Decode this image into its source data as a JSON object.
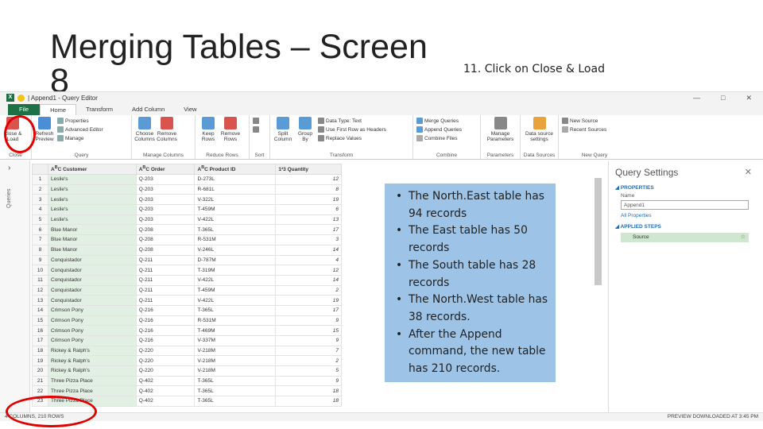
{
  "slide": {
    "title": "Merging Tables – Screen 8",
    "instruction": "11. Click on Close & Load"
  },
  "window": {
    "title": "| Append1 - Query Editor",
    "file_tab": "File",
    "tabs": [
      "Home",
      "Transform",
      "Add Column",
      "View"
    ],
    "controls": [
      "—",
      "□",
      "✕"
    ]
  },
  "ribbon": {
    "close_load": "Close & Load",
    "refresh_preview": "Refresh Preview",
    "properties": "Properties",
    "advanced_editor": "Advanced Editor",
    "manage": "Manage",
    "choose_columns": "Choose Columns",
    "remove_columns": "Remove Columns",
    "keep_rows": "Keep Rows",
    "remove_rows": "Remove Rows",
    "split_column": "Split Column",
    "group_by": "Group By",
    "data_type": "Data Type: Text",
    "first_row_headers": "Use First Row as Headers",
    "replace_values": "Replace Values",
    "merge_queries": "Merge Queries",
    "append_queries": "Append Queries",
    "combine_files": "Combine Files",
    "manage_parameters": "Manage Parameters",
    "data_source_settings": "Data source settings",
    "new_source": "New Source",
    "recent_sources": "Recent Sources",
    "groups": [
      "Close",
      "Query",
      "Manage Columns",
      "Reduce Rows",
      "Sort",
      "Transform",
      "Combine",
      "Parameters",
      "Data Sources",
      "New Query"
    ]
  },
  "sidebar": {
    "label": "Queries",
    "chevron": "›"
  },
  "table": {
    "headers": [
      "Customer",
      "Order",
      "Product ID",
      "Quantity"
    ],
    "rows": [
      [
        "1",
        "Leslie's",
        "Q-203",
        "D-273L",
        "12"
      ],
      [
        "2",
        "Leslie's",
        "Q-203",
        "R-681L",
        "8"
      ],
      [
        "3",
        "Leslie's",
        "Q-203",
        "V-322L",
        "19"
      ],
      [
        "4",
        "Leslie's",
        "Q-203",
        "T-459M",
        "6"
      ],
      [
        "5",
        "Leslie's",
        "Q-203",
        "V-422L",
        "13"
      ],
      [
        "6",
        "Blue Manor",
        "Q-208",
        "T-365L",
        "17"
      ],
      [
        "7",
        "Blue Manor",
        "Q-208",
        "R-531M",
        "3"
      ],
      [
        "8",
        "Blue Manor",
        "Q-208",
        "V-246L",
        "14"
      ],
      [
        "9",
        "Conquistador",
        "Q-211",
        "D-787M",
        "4"
      ],
      [
        "10",
        "Conquistador",
        "Q-211",
        "T-319M",
        "12"
      ],
      [
        "11",
        "Conquistador",
        "Q-211",
        "V-422L",
        "14"
      ],
      [
        "12",
        "Conquistador",
        "Q-211",
        "T-459M",
        "2"
      ],
      [
        "13",
        "Conquistador",
        "Q-211",
        "V-422L",
        "19"
      ],
      [
        "14",
        "Crimson Pony",
        "Q-216",
        "T-365L",
        "17"
      ],
      [
        "15",
        "Crimson Pony",
        "Q-216",
        "R-531M",
        "9"
      ],
      [
        "16",
        "Crimson Pony",
        "Q-216",
        "T-469M",
        "15"
      ],
      [
        "17",
        "Crimson Pony",
        "Q-216",
        "V-337M",
        "9"
      ],
      [
        "18",
        "Rickey & Ralph's",
        "Q-220",
        "V-218M",
        "7"
      ],
      [
        "19",
        "Rickey & Ralph's",
        "Q-220",
        "V-218M",
        "2"
      ],
      [
        "20",
        "Rickey & Ralph's",
        "Q-220",
        "V-218M",
        "5"
      ],
      [
        "21",
        "Three Pizza Place",
        "Q-402",
        "T-365L",
        "9"
      ],
      [
        "22",
        "Three Pizza Place",
        "Q-402",
        "T-365L",
        "18"
      ],
      [
        "23",
        "Three Pizza Place",
        "Q-402",
        "T-365L",
        "18"
      ]
    ]
  },
  "query_settings": {
    "title": "Query Settings",
    "properties_header": "PROPERTIES",
    "name_label": "Name",
    "name_value": "Append1",
    "all_properties": "All Properties",
    "applied_steps_header": "APPLIED STEPS",
    "step": "Source"
  },
  "status": {
    "left": "4 COLUMNS, 210 ROWS",
    "right": "PREVIEW DOWNLOADED AT 3:45 PM"
  },
  "note": {
    "bullets": [
      "The North.East table has 94 records",
      "The East table has 50 records",
      "The South table has 28 records",
      "The North.West table has 38 records.",
      "After the Append command, the new table has 210 records."
    ]
  },
  "colors": {
    "excel_green": "#1e7145",
    "note_blue": "#9dc3e6",
    "highlight_red": "#e00000",
    "customer_col": "#e2f0e4"
  }
}
